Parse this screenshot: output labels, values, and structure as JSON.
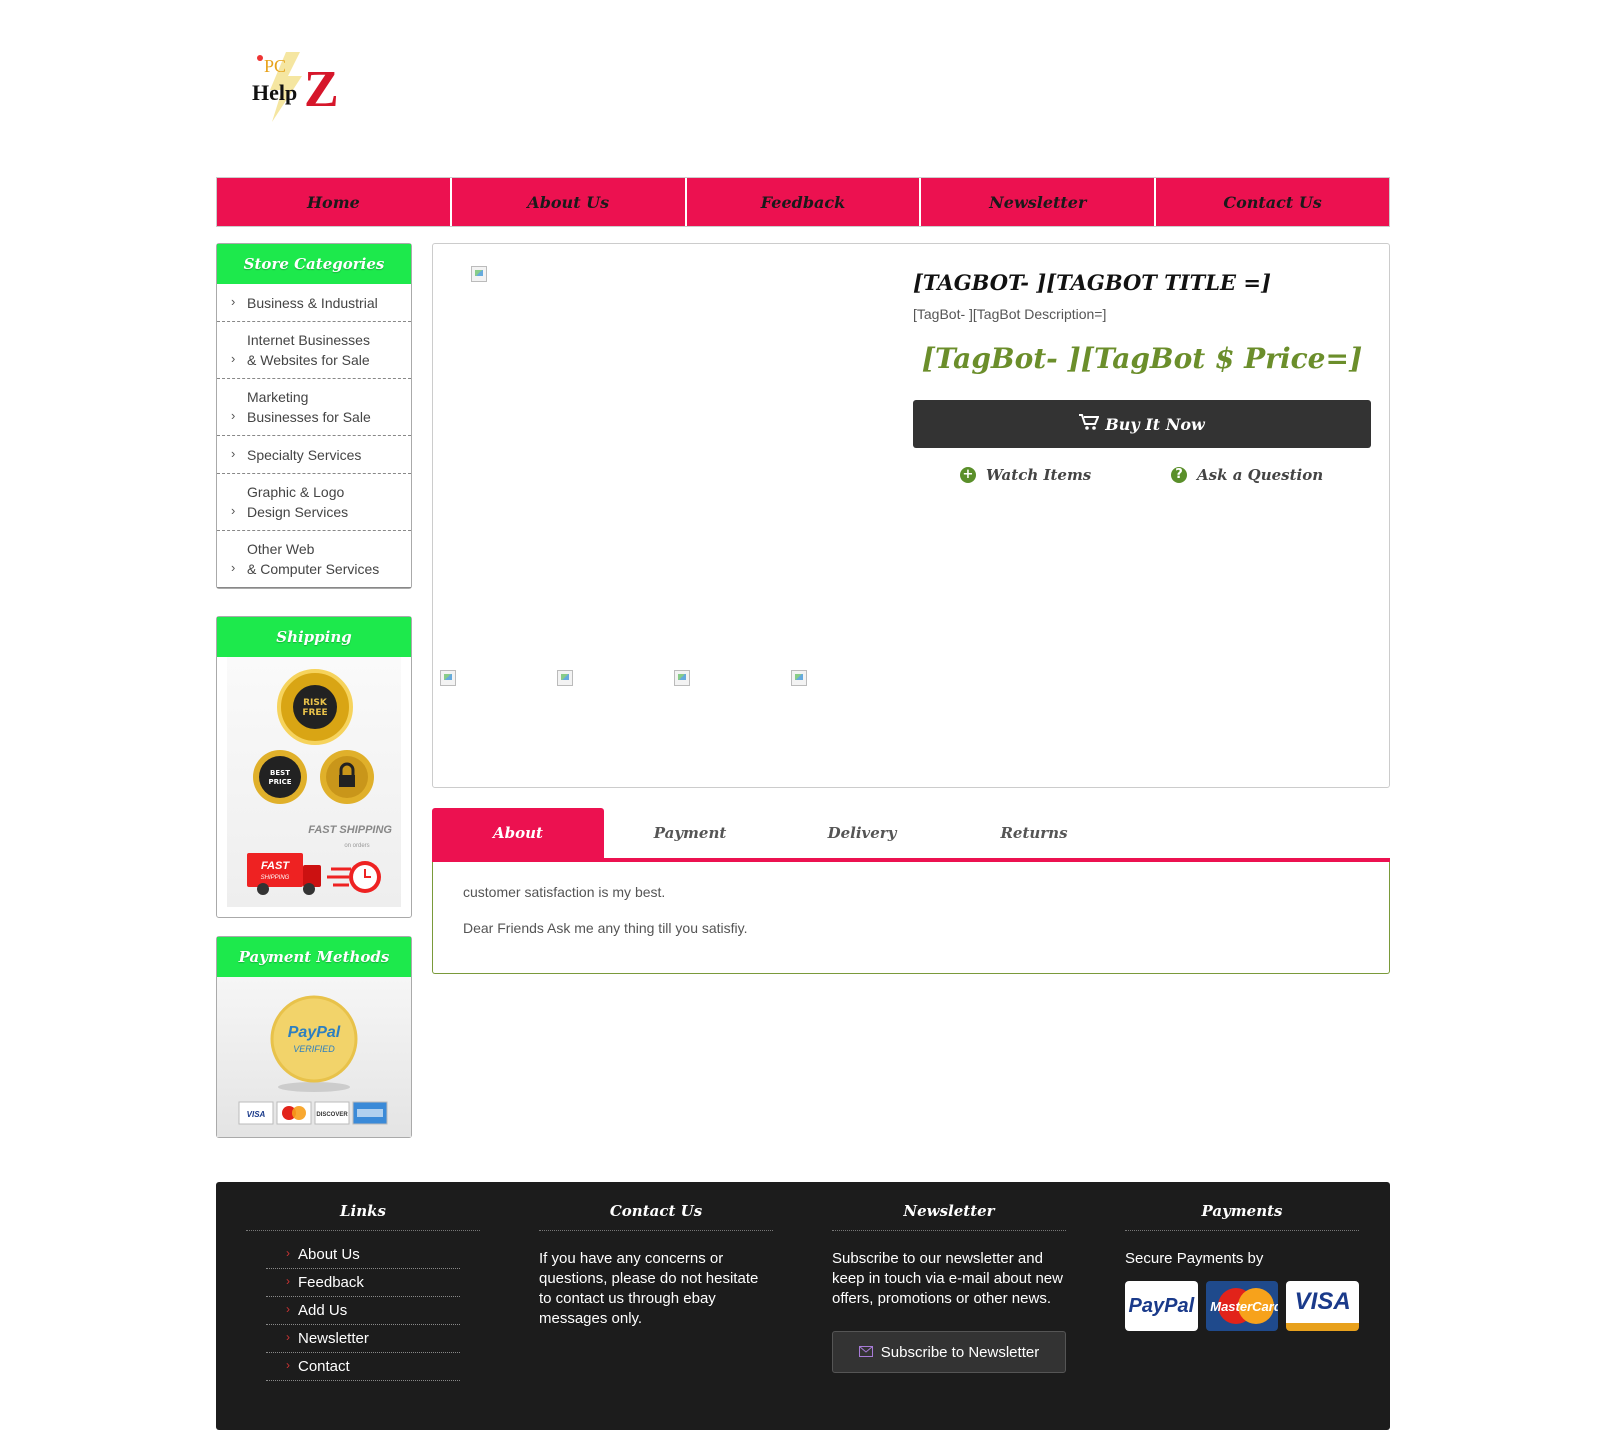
{
  "logo": {
    "small_text": "PC",
    "main_text": "Help",
    "big_letter": "Z"
  },
  "nav": [
    "Home",
    "About Us",
    "Feedback",
    "Newsletter",
    "Contact Us"
  ],
  "categories": {
    "title": "Store Categories",
    "items": [
      "Business & Industrial",
      "Internet Businesses\n& Websites for Sale",
      "Marketing\nBusinesses for Sale",
      "Specialty Services",
      "Graphic & Logo\nDesign Services",
      "Other Web\n& Computer Services"
    ]
  },
  "shipping": {
    "title": "Shipping",
    "seal_risk": [
      "RISK",
      "FREE"
    ],
    "seal_best": [
      "BEST",
      "PRICE"
    ],
    "fast_label": "FAST SHIPPING",
    "fast_sub": "on orders",
    "truck_text": [
      "FAST",
      "SHIPPING"
    ]
  },
  "payment_methods": {
    "title": "Payment Methods",
    "seal_main": "PayPal",
    "seal_sub": "VERIFIED",
    "cards": [
      "VISA",
      "",
      "DISCOVER",
      ""
    ]
  },
  "product": {
    "title": "[TAGBOT- ][TAGBOT TITLE =]",
    "description": "[TagBot- ][TagBot Description=]",
    "price": "[TagBot- ][TagBot $ Price=]",
    "buy_label": "Buy It Now",
    "watch_label": "Watch Items",
    "ask_label": "Ask a Question"
  },
  "tabs": {
    "items": [
      "About",
      "Payment",
      "Delivery",
      "Returns"
    ],
    "active": "About",
    "about_lines": [
      "customer satisfaction is my best.",
      "Dear Friends Ask me any thing till you satisfiy."
    ]
  },
  "footer": {
    "links": {
      "title": "Links",
      "items": [
        "About Us",
        "Feedback",
        "Add Us",
        "Newsletter",
        "Contact"
      ]
    },
    "contact": {
      "title": "Contact Us",
      "text": "If you have any concerns or questions, please do not hesitate to contact us through ebay messages only."
    },
    "newsletter": {
      "title": "Newsletter",
      "text": "Subscribe to our newsletter and keep in touch via e-mail about new offers, promotions or other news.",
      "button": "Subscribe to Newsletter"
    },
    "payments": {
      "title": "Payments",
      "text": "Secure Payments by",
      "cards": [
        "PayPal",
        "MasterCard",
        "VISA"
      ]
    }
  },
  "colors": {
    "accent": "#ec1150",
    "green": "#1de94c",
    "price": "#6b8e2b",
    "footer_bg": "#1c1c1c"
  }
}
